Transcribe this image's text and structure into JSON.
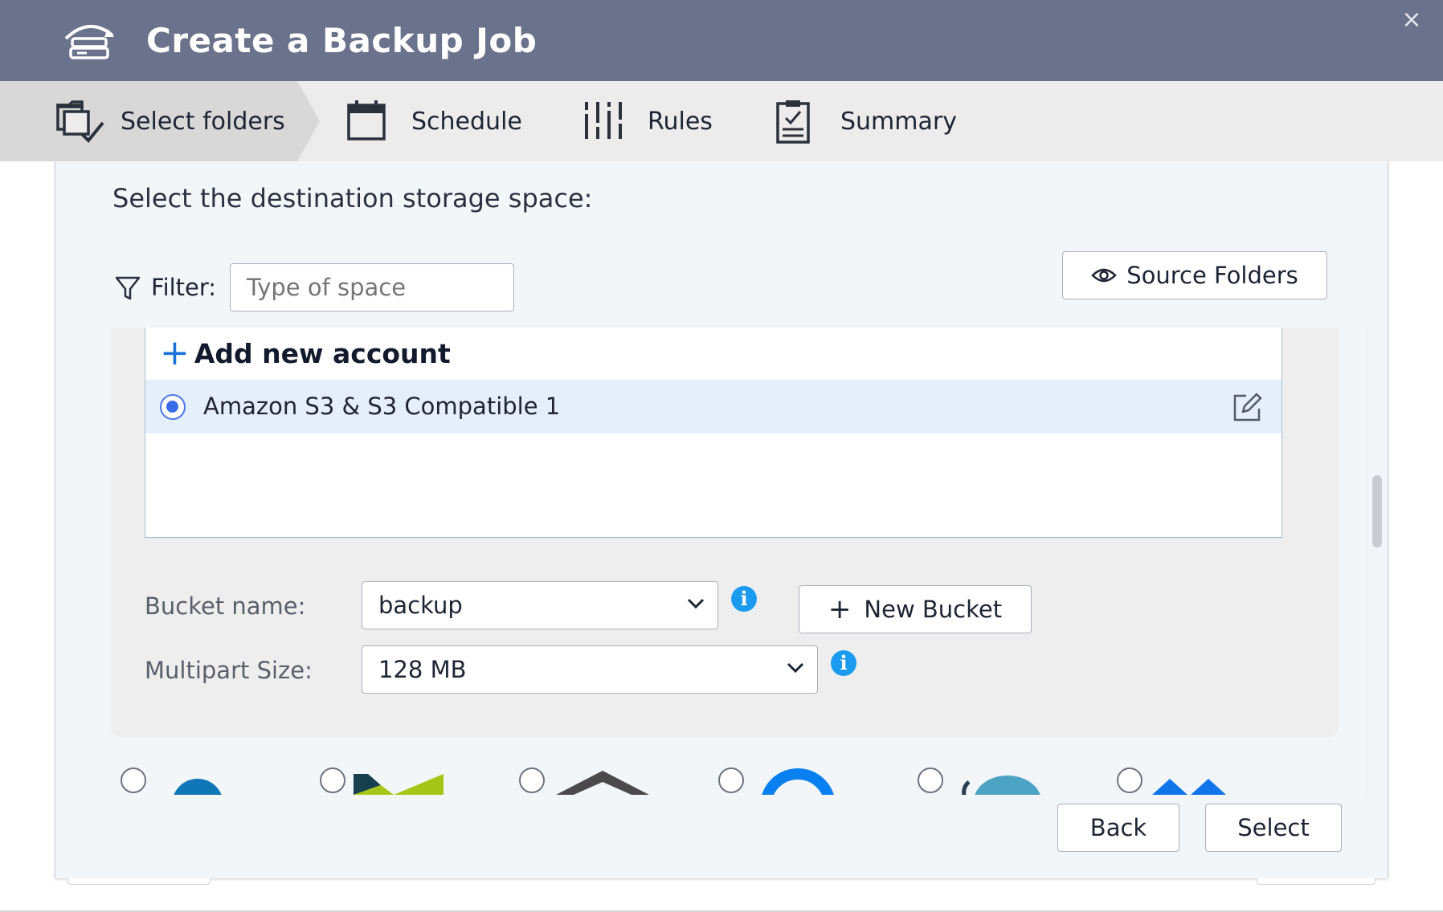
{
  "window": {
    "title": "Create a Backup Job",
    "close_glyph": "×",
    "app_icon": "backup-drive-icon"
  },
  "steps": [
    {
      "label": "Select folders",
      "icon": "folder-check-icon",
      "active": true
    },
    {
      "label": "Schedule",
      "icon": "calendar-icon",
      "active": false
    },
    {
      "label": "Rules",
      "icon": "sliders-icon",
      "active": false
    },
    {
      "label": "Summary",
      "icon": "clipboard-check-icon",
      "active": false
    }
  ],
  "main": {
    "heading": "Select the destination storage space:",
    "filter": {
      "label": "Filter:",
      "placeholder": "Type of space",
      "value": ""
    },
    "source_folders_button": "Source Folders",
    "accounts": {
      "add_label": "Add new account",
      "items": [
        {
          "name": "Amazon S3 & S3 Compatible 1",
          "selected": true
        }
      ]
    },
    "bucket": {
      "label": "Bucket name:",
      "value": "backup",
      "new_bucket_button": "New Bucket"
    },
    "multipart": {
      "label": "Multipart Size:",
      "value": "128 MB"
    },
    "providers": [
      "provider-1",
      "provider-2",
      "provider-3",
      "provider-4",
      "provider-5",
      "provider-6"
    ]
  },
  "footer": {
    "back_label": "Back",
    "select_label": "Select"
  },
  "colors": {
    "titlebar": "#6b728c",
    "accent": "#3a6be6",
    "info": "#1a9bf0",
    "selected_row": "#e5eefb"
  }
}
